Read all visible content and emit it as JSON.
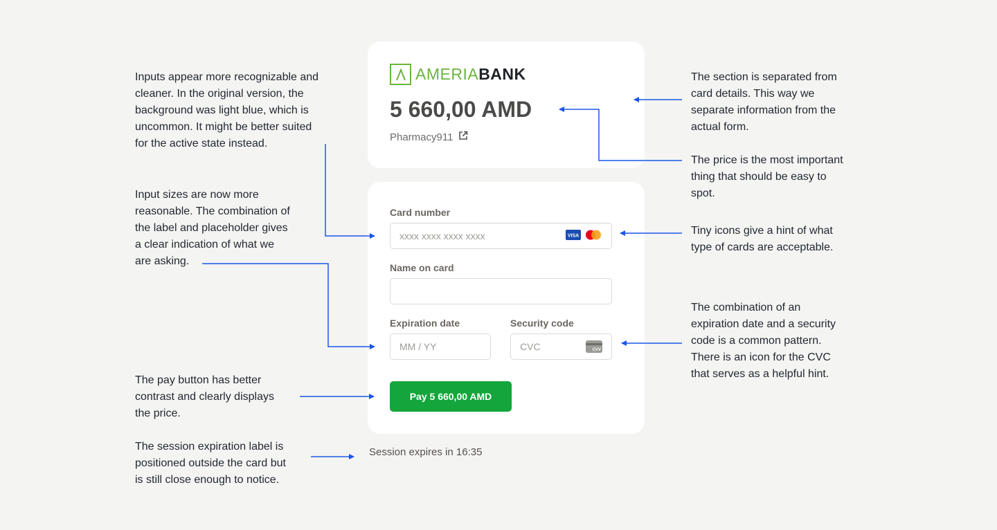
{
  "brand": {
    "first": "AMERIA",
    "second": "BANK",
    "color": "#6ab43e"
  },
  "summary": {
    "amount": "5 660,00 AMD",
    "merchant": "Pharmacy911"
  },
  "form": {
    "card_number": {
      "label": "Card number",
      "placeholder": "xxxx xxxx xxxx xxxx"
    },
    "name_on_card": {
      "label": "Name on card",
      "placeholder": ""
    },
    "expiration": {
      "label": "Expiration date",
      "placeholder": "MM / YY"
    },
    "security": {
      "label": "Security code",
      "placeholder": "CVC"
    },
    "pay_label": "Pay 5 660,00 AMD",
    "card_icons": [
      "visa-icon",
      "mastercard-icon"
    ],
    "cvv_icon_text": "CVV"
  },
  "session": "Session expires in 16:35",
  "notes": {
    "inputs_clean": "Inputs appear more recognizable and\ncleaner. In the original version, the\nbackground was light blue, which is\nuncommon. It might be better suited\nfor the active state instead.",
    "input_sizes": "Input sizes are now more\nreasonable. The combination of\nthe label and placeholder gives\na clear indication of what we\nare asking.",
    "pay_button": "The pay button has better\ncontrast and clearly displays\nthe price.",
    "session_label": "The session expiration label is\npositioned outside the card but\nis still close enough to notice.",
    "section_separated": "The section is separated from\ncard details. This way we\nseparate information from the\nactual form.",
    "price_important": "The price is the most important\nthing that should be easy to\nspot.",
    "tiny_icons": "Tiny icons give a hint of what\ntype of cards are acceptable.",
    "expiration_combo": "The combination of an\nexpiration date and a security\ncode is a common pattern.\nThere is an icon for the CVC\nthat serves as a helpful hint."
  },
  "colors": {
    "background": "#f4f4f2",
    "pay": "#14a53c",
    "annotation": "#1a56e8"
  }
}
